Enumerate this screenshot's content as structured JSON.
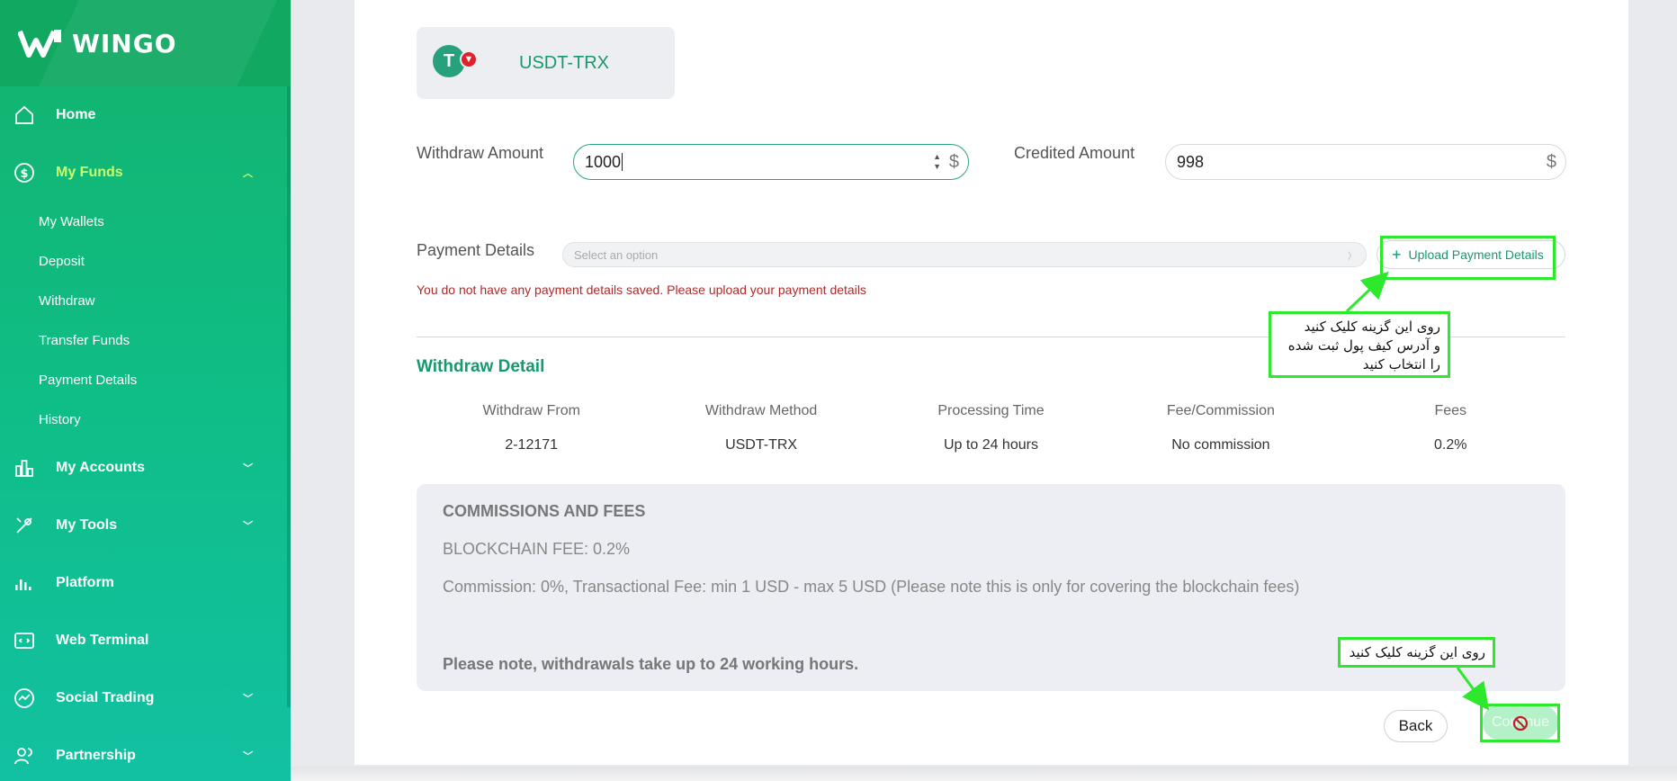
{
  "brand": {
    "name": "WINGO"
  },
  "sidebar": {
    "items": [
      {
        "label": "Home",
        "icon": "home-icon"
      },
      {
        "label": "My Funds",
        "icon": "dollar-circle-icon",
        "active": true,
        "expanded": true,
        "children": [
          "My Wallets",
          "Deposit",
          "Withdraw",
          "Transfer Funds",
          "Payment Details",
          "History"
        ]
      },
      {
        "label": "My Accounts",
        "icon": "bar-chart-icon"
      },
      {
        "label": "My Tools",
        "icon": "tools-icon"
      },
      {
        "label": "Platform",
        "icon": "signal-bars-icon"
      },
      {
        "label": "Web Terminal",
        "icon": "terminal-icon"
      },
      {
        "label": "Social Trading",
        "icon": "trend-circle-icon"
      },
      {
        "label": "Partnership",
        "icon": "users-icon"
      }
    ]
  },
  "method": {
    "label": "USDT-TRX",
    "icon": "tether-tron-icon"
  },
  "form": {
    "withdraw_label": "Withdraw Amount",
    "withdraw_value": "1000",
    "credited_label": "Credited Amount",
    "credited_value": "998",
    "currency_symbol": "$",
    "payment_label": "Payment Details",
    "payment_placeholder": "Select an option",
    "upload_label": "Upload Payment Details",
    "error": "You do not have any payment details saved. Please upload your payment details"
  },
  "withdraw_detail": {
    "title": "Withdraw Detail",
    "headers": [
      "Withdraw From",
      "Withdraw Method",
      "Processing Time",
      "Fee/Commission",
      "Fees"
    ],
    "values": [
      "2-12171",
      "USDT-TRX",
      "Up to 24 hours",
      "No commission",
      "0.2%"
    ]
  },
  "fees": {
    "title": "COMMISSIONS AND FEES",
    "blockchain": "BLOCKCHAIN FEE: 0.2%",
    "commission": "Commission: 0%, Transactional Fee: min 1 USD - max 5 USD (Please note this is only for covering the blockchain fees)",
    "note": "Please note, withdrawals take up to 24 working hours."
  },
  "buttons": {
    "back": "Back",
    "continue": "Continue"
  },
  "annotations": {
    "callout_upload": [
      "روی این گزینه کلیک کنید",
      "و آدرس کیف پول ثبت شده",
      "را انتخاب کنید"
    ],
    "callout_continue": "روی این گزینه کلیک کنید",
    "highlight_color": "#2ee82e"
  },
  "colors": {
    "brand_green": "#13b36c",
    "accent_text": "#159a6e",
    "error": "#b02a2a",
    "active_nav": "#c9ff6e"
  }
}
